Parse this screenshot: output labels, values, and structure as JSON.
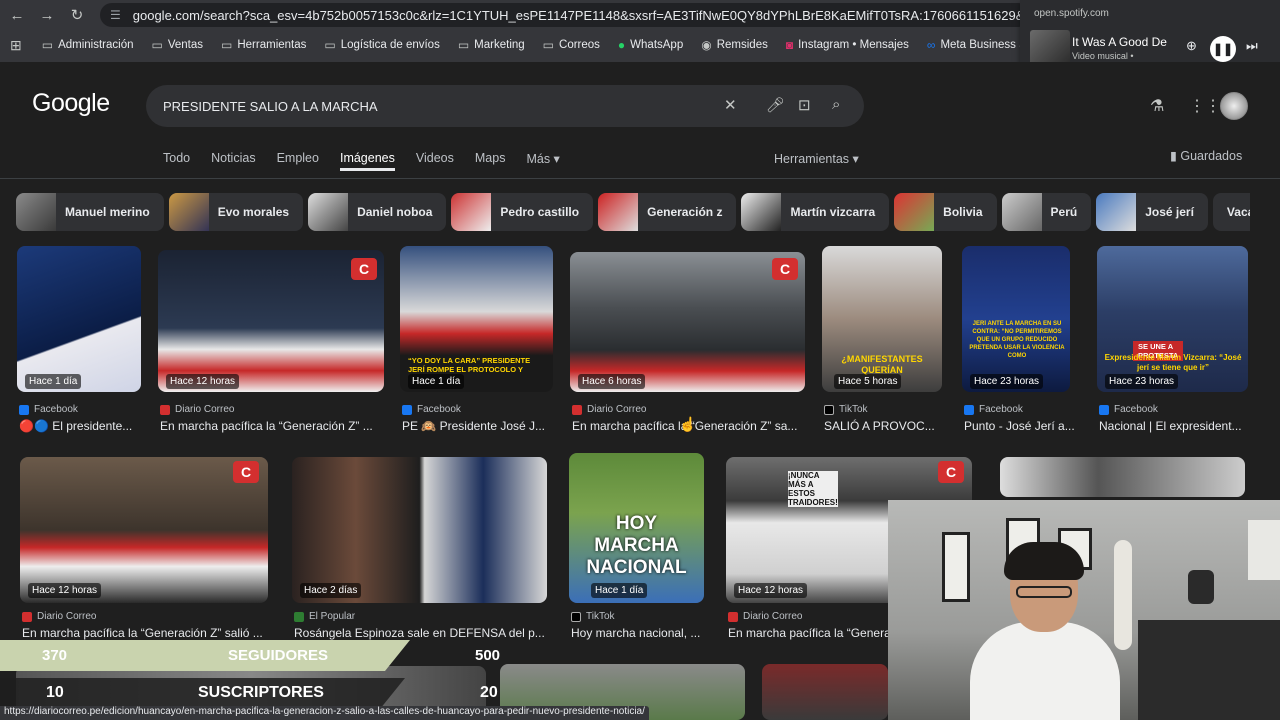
{
  "browser": {
    "url": "google.com/search?sca_esv=4b752b0057153c0c&rlz=1C1YTUH_esPE1147PE1148&sxsrf=AE3TifNwE0QY8dYPhLBrE8KaEMifT0TsRA:1760661151629&udm=2&fbs=AIljpHx4nJj",
    "bookmarks": [
      "Administración",
      "Ventas",
      "Herramientas",
      "Logística de envíos",
      "Marketing",
      "Correos",
      "WhatsApp",
      "Remsides",
      "Instagram • Mensajes",
      "Meta Business Suite"
    ],
    "status_url": "https://diariocorreo.pe/edicion/huancayo/en-marcha-pacifica-la-generacion-z-salio-a-las-calles-de-huancayo-para-pedir-nuevo-presidente-noticia/"
  },
  "media": {
    "source": "open.spotify.com",
    "title": "It Was A Good De",
    "subtitle": "Video musical •"
  },
  "google": {
    "logo": "Google",
    "query": "PRESIDENTE SALIO A LA MARCHA",
    "tabs": [
      "Todo",
      "Noticias",
      "Empleo",
      "Imágenes",
      "Videos",
      "Maps",
      "Más ▾"
    ],
    "tools": "Herramientas ▾",
    "saved": "Guardados",
    "chips": [
      "Manuel merino",
      "Evo morales",
      "Daniel noboa",
      "Pedro castillo",
      "Generación z",
      "Martín vizcarra",
      "Bolivia",
      "Perú",
      "José jerí",
      "Vacanc"
    ]
  },
  "results": [
    {
      "time": "Hace 1 día",
      "source": "Facebook",
      "title": "🔴🔵 El presidente..."
    },
    {
      "time": "Hace 12 horas",
      "source": "Diario Correo",
      "title": "En marcha pacífica la “Generación Z” ..."
    },
    {
      "time": "Hace 1 día",
      "source": "Facebook",
      "title": "PE 🙉 Presidente José J..."
    },
    {
      "time": "Hace 6 horas",
      "source": "Diario Correo",
      "title": "En marcha pacífica la “Generación Z” sa..."
    },
    {
      "time": "Hace 5 horas",
      "source": "TikTok",
      "title": "SALIÓ A PROVOC..."
    },
    {
      "time": "Hace 23 horas",
      "source": "Facebook",
      "title": "Punto - José Jerí a..."
    },
    {
      "time": "Hace 23 horas",
      "source": "Facebook",
      "title": "Nacional | El expresident..."
    },
    {
      "time": "Hace 12 horas",
      "source": "Diario Correo",
      "title": "En marcha pacífica la “Generación Z” salió ..."
    },
    {
      "time": "Hace 2 días",
      "source": "El Popular",
      "title": "Rosángela Espinoza sale en DEFENSA del p..."
    },
    {
      "time": "Hace 1 día",
      "source": "TikTok",
      "title": "Hoy marcha nacional, ..."
    },
    {
      "time": "Hace 12 horas",
      "source": "Diario Correo",
      "title": "En marcha pacífica la “Genera"
    }
  ],
  "image_text": {
    "r3_caption": "“YO DOY LA CARA” PRESIDENTE JERÍ ROMPE EL PROTOCOLO Y HABLA CON LOS MANIFESTANTES EN PLAZA DE ARMAS",
    "r5_caption": "¿MANIFESTANTES QUERÍAN",
    "r6_caption": "JERÍ ANTE LA MARCHA EN SU CONTRA: “NO PERMITIREMOS QUE UN GRUPO REDUCIDO PRETENDA USAR LA VIOLENCIA COMO",
    "r7_banner": "SE UNE A PROTESTA",
    "r7_caption": "Expresidente Martín Vizcarra: “José jerí se tiene que ir”",
    "r10_caption": "HOY MARCHA NACIONAL",
    "r11_banner": "¡NUNCA MÁS A ESTOS TRAIDORES!",
    "badge": "C"
  },
  "overlay": {
    "followers_count": "370",
    "followers_label": "SEGUIDORES",
    "followers_goal": "500",
    "subs_count": "10",
    "subs_label": "SUSCRIPTORES",
    "subs_goal": "20"
  }
}
